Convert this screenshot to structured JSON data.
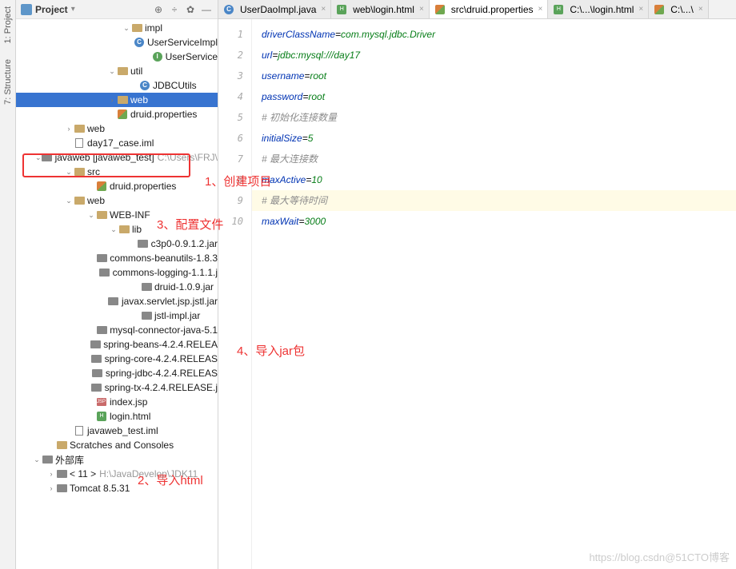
{
  "sidebar": {
    "title": "Project",
    "items": [
      {
        "indent": 112,
        "arrow": "v",
        "icon": "folder",
        "label": "impl"
      },
      {
        "indent": 140,
        "arrow": "",
        "icon": "class",
        "label": "UserServiceImpl"
      },
      {
        "indent": 140,
        "arrow": "",
        "icon": "interface",
        "label": "UserService"
      },
      {
        "indent": 94,
        "arrow": "v",
        "icon": "folder",
        "label": "util"
      },
      {
        "indent": 122,
        "arrow": "",
        "icon": "class",
        "label": "JDBCUtils"
      },
      {
        "indent": 94,
        "arrow": ">",
        "icon": "folder",
        "label": "web",
        "selected": true
      },
      {
        "indent": 94,
        "arrow": "",
        "icon": "prop",
        "label": "druid.properties"
      },
      {
        "indent": 40,
        "arrow": ">",
        "icon": "folder",
        "label": "web"
      },
      {
        "indent": 40,
        "arrow": "",
        "icon": "file",
        "label": "day17_case.iml"
      },
      {
        "indent": 18,
        "arrow": "v",
        "icon": "module",
        "label": "javaweb [javaweb_test]",
        "dim": "C:\\Users\\FRJ\\"
      },
      {
        "indent": 40,
        "arrow": "v",
        "icon": "folder",
        "label": "src"
      },
      {
        "indent": 68,
        "arrow": "",
        "icon": "prop",
        "label": "druid.properties"
      },
      {
        "indent": 40,
        "arrow": "v",
        "icon": "folder",
        "label": "web"
      },
      {
        "indent": 68,
        "arrow": "v",
        "icon": "folder",
        "label": "WEB-INF"
      },
      {
        "indent": 96,
        "arrow": "v",
        "icon": "folder",
        "label": "lib"
      },
      {
        "indent": 124,
        "arrow": "",
        "icon": "lib",
        "label": "c3p0-0.9.1.2.jar"
      },
      {
        "indent": 124,
        "arrow": "",
        "icon": "lib",
        "label": "commons-beanutils-1.8.3"
      },
      {
        "indent": 124,
        "arrow": "",
        "icon": "lib",
        "label": "commons-logging-1.1.1.j"
      },
      {
        "indent": 124,
        "arrow": "",
        "icon": "lib",
        "label": "druid-1.0.9.jar"
      },
      {
        "indent": 124,
        "arrow": "",
        "icon": "lib",
        "label": "javax.servlet.jsp.jstl.jar"
      },
      {
        "indent": 124,
        "arrow": "",
        "icon": "lib",
        "label": "jstl-impl.jar"
      },
      {
        "indent": 124,
        "arrow": "",
        "icon": "lib",
        "label": "mysql-connector-java-5.1"
      },
      {
        "indent": 124,
        "arrow": "",
        "icon": "lib",
        "label": "spring-beans-4.2.4.RELEA"
      },
      {
        "indent": 124,
        "arrow": "",
        "icon": "lib",
        "label": "spring-core-4.2.4.RELEAS"
      },
      {
        "indent": 124,
        "arrow": "",
        "icon": "lib",
        "label": "spring-jdbc-4.2.4.RELEAS"
      },
      {
        "indent": 124,
        "arrow": "",
        "icon": "lib",
        "label": "spring-tx-4.2.4.RELEASE.j"
      },
      {
        "indent": 68,
        "arrow": "",
        "icon": "jsp",
        "label": "index.jsp"
      },
      {
        "indent": 68,
        "arrow": "",
        "icon": "html",
        "label": "login.html"
      },
      {
        "indent": 40,
        "arrow": "",
        "icon": "file",
        "label": "javaweb_test.iml"
      },
      {
        "indent": 18,
        "arrow": "",
        "icon": "folder",
        "label": "Scratches and Consoles"
      },
      {
        "indent": 0,
        "arrow": "v",
        "icon": "lib",
        "label": "外部库"
      },
      {
        "indent": 18,
        "arrow": ">",
        "icon": "lib",
        "label": "< 11 >",
        "dim": "H:\\JavaDevelop\\JDK11"
      },
      {
        "indent": 18,
        "arrow": ">",
        "icon": "lib",
        "label": "Tomcat 8.5.31"
      }
    ]
  },
  "tabs": [
    {
      "icon": "class",
      "label": "UserDaoImpl.java",
      "active": false
    },
    {
      "icon": "html",
      "label": "web\\login.html",
      "active": false
    },
    {
      "icon": "prop",
      "label": "src\\druid.properties",
      "active": true
    },
    {
      "icon": "html",
      "label": "C:\\...\\login.html",
      "active": false
    },
    {
      "icon": "prop",
      "label": "C:\\...\\",
      "active": false
    }
  ],
  "code": {
    "lines": [
      [
        {
          "t": "driverClassName",
          "c": "tk-key"
        },
        {
          "t": "="
        },
        {
          "t": "com.mysql.jdbc.Driver",
          "c": "tk-val"
        }
      ],
      [
        {
          "t": "url",
          "c": "tk-key"
        },
        {
          "t": "="
        },
        {
          "t": "jdbc:mysql:///day17",
          "c": "tk-val"
        }
      ],
      [
        {
          "t": "username",
          "c": "tk-key"
        },
        {
          "t": "="
        },
        {
          "t": "root",
          "c": "tk-val"
        }
      ],
      [
        {
          "t": "password",
          "c": "tk-key"
        },
        {
          "t": "="
        },
        {
          "t": "root",
          "c": "tk-val"
        }
      ],
      [
        {
          "t": "# 初始化连接数量",
          "c": "tk-comment"
        }
      ],
      [
        {
          "t": "initialSize",
          "c": "tk-key"
        },
        {
          "t": "="
        },
        {
          "t": "5",
          "c": "tk-val"
        }
      ],
      [
        {
          "t": "# 最大连接数",
          "c": "tk-comment"
        }
      ],
      [
        {
          "t": "maxActive",
          "c": "tk-key"
        },
        {
          "t": "="
        },
        {
          "t": "10",
          "c": "tk-val"
        }
      ],
      [
        {
          "t": "# 最大等待时间",
          "c": "tk-comment"
        }
      ],
      [
        {
          "t": "maxWait",
          "c": "tk-key"
        },
        {
          "t": "="
        },
        {
          "t": "3000",
          "c": "tk-val"
        }
      ]
    ],
    "highlight_line": 9
  },
  "annotations": {
    "a1": "1、创建项目",
    "a2": "2、导入html",
    "a3": "3、配置文件",
    "a4": "4、导入jar包"
  },
  "watermark": "https://blog.csdn@51CTO博客",
  "left_gutter": {
    "t1": "1: Project",
    "t2": "7: Structure"
  }
}
